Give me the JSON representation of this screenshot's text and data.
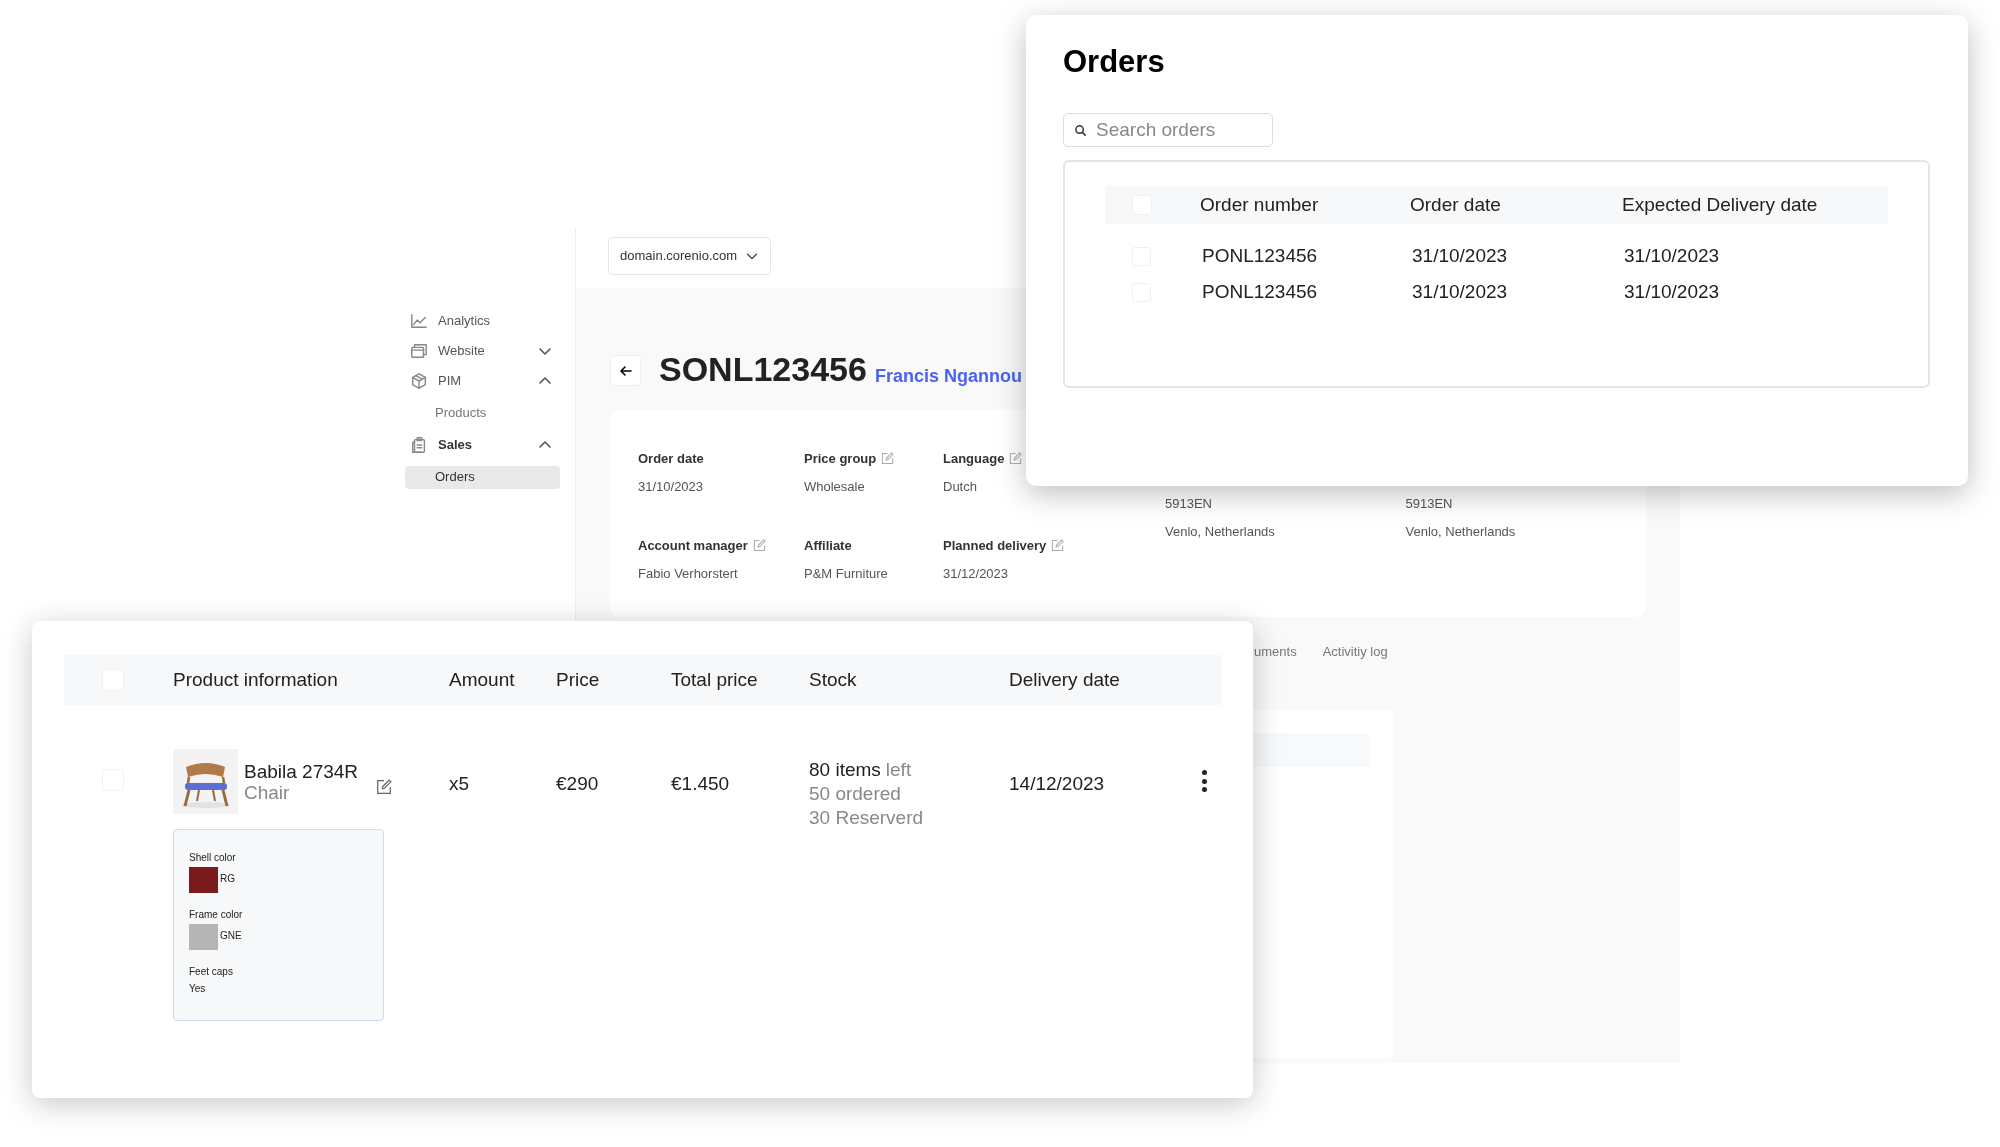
{
  "back_window": {
    "domain_select": "domain.corenio.com",
    "sidebar": {
      "items": [
        {
          "label": "Analytics"
        },
        {
          "label": "Website",
          "expanded": false
        },
        {
          "label": "PIM",
          "expanded": true,
          "children": [
            {
              "label": "Products",
              "selected": false
            }
          ]
        },
        {
          "label": "Sales",
          "expanded": true,
          "children": [
            {
              "label": "Orders",
              "selected": true
            }
          ]
        }
      ]
    },
    "order": {
      "number": "SONL123456",
      "customer": "Francis Ngannou",
      "fields": [
        {
          "label": "Order date",
          "value": "31/10/2023",
          "editable": false
        },
        {
          "label": "Price group",
          "value": "Wholesale",
          "editable": true
        },
        {
          "label": "Language",
          "value": "Dutch",
          "editable": true
        },
        {
          "label": "Account manager",
          "value": "Fabio Verhorstert",
          "editable": true
        },
        {
          "label": "Affiliate",
          "value": "P&M Furniture",
          "editable": false
        },
        {
          "label": "Planned delivery",
          "value": "31/12/2023",
          "editable": true
        }
      ],
      "addresses": [
        {
          "postcode": "5913EN",
          "city": "Venlo, Netherlands"
        },
        {
          "postcode": "5913EN",
          "city": "Venlo, Netherlands"
        }
      ]
    },
    "tabs": [
      {
        "label": "uments"
      },
      {
        "label": "Activitiy log"
      }
    ]
  },
  "product_table": {
    "all_checked": false,
    "columns": [
      "Product information",
      "Amount",
      "Price",
      "Total price",
      "Stock",
      "Delivery date"
    ],
    "rows": [
      {
        "checked": false,
        "name": "Babila 2734R",
        "type": "Chair",
        "amount": "x5",
        "price": "€290",
        "total": "€1.450",
        "stock_count": "80 items",
        "stock_left": "left",
        "ordered": "50 ordered",
        "reserved": "30 Reserverd",
        "delivery_date": "14/12/2023",
        "options": [
          {
            "label": "Shell color",
            "color": "#7b1a1c",
            "value": "RG"
          },
          {
            "label": "Frame color",
            "color": "#b5b5b5",
            "value": "GNE"
          },
          {
            "label": "Feet caps",
            "value": "Yes"
          }
        ]
      }
    ]
  },
  "orders_panel": {
    "title": "Orders",
    "search": {
      "placeholder": "Search orders"
    },
    "all_checked": false,
    "columns": [
      "Order number",
      "Order date",
      "Expected Delivery date"
    ],
    "rows": [
      {
        "checked": false,
        "order_number": "PONL123456",
        "order_date": "31/10/2023",
        "expected_delivery": "31/10/2023"
      },
      {
        "checked": false,
        "order_number": "PONL123456",
        "order_date": "31/10/2023",
        "expected_delivery": "31/10/2023"
      }
    ]
  }
}
